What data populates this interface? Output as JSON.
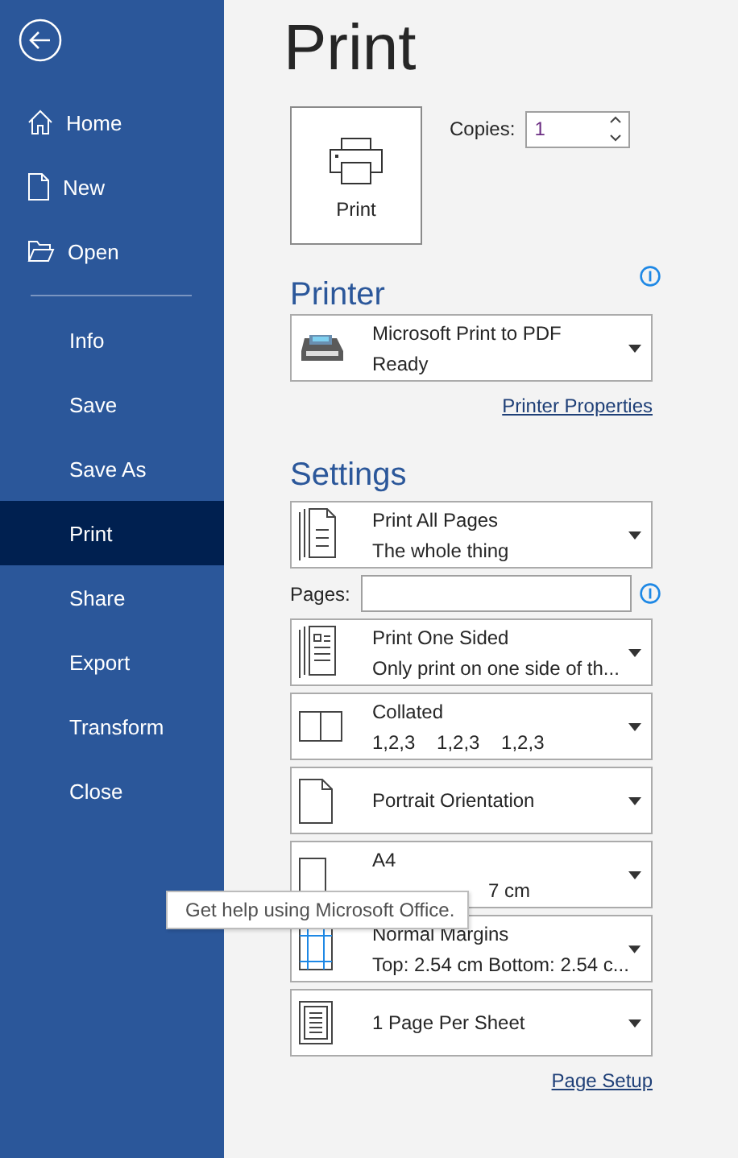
{
  "sidebar": {
    "items": [
      {
        "label": "Home",
        "selected": false
      },
      {
        "label": "New",
        "selected": false
      },
      {
        "label": "Open",
        "selected": false
      },
      {
        "kind": "divider"
      },
      {
        "label": "Info",
        "selected": false
      },
      {
        "label": "Save",
        "selected": false
      },
      {
        "label": "Save As",
        "selected": false
      },
      {
        "label": "Print",
        "selected": true
      },
      {
        "label": "Share",
        "selected": false
      },
      {
        "label": "Export",
        "selected": false
      },
      {
        "label": "Transform",
        "selected": false
      },
      {
        "label": "Close",
        "selected": false
      }
    ]
  },
  "title": "Print",
  "print_button": {
    "label": "Print"
  },
  "copies": {
    "label": "Copies:",
    "value": "1"
  },
  "printer": {
    "heading": "Printer",
    "name": "Microsoft Print to PDF",
    "status": "Ready",
    "link": "Printer Properties"
  },
  "settings": {
    "heading": "Settings",
    "items": [
      {
        "kind": "pages",
        "title": "Print All Pages",
        "subtitle": "The whole thing"
      },
      {
        "kind": "range",
        "label": "Pages:"
      },
      {
        "kind": "sides",
        "title": "Print One Sided",
        "subtitle": "Only print on one side of th..."
      },
      {
        "kind": "collate",
        "title": "Collated",
        "subtitle": "1,2,3    1,2,3    1,2,3"
      },
      {
        "kind": "orientation",
        "title": "Portrait Orientation"
      },
      {
        "kind": "size",
        "title": "A4",
        "subtitle": "7 cm"
      },
      {
        "kind": "margins",
        "title": "Normal Margins",
        "subtitle": "Top: 2.54 cm Bottom: 2.54 c..."
      },
      {
        "kind": "persheet",
        "title": "1 Page Per Sheet"
      }
    ],
    "link": "Page Setup"
  },
  "tooltip": "Get help using Microsoft Office."
}
